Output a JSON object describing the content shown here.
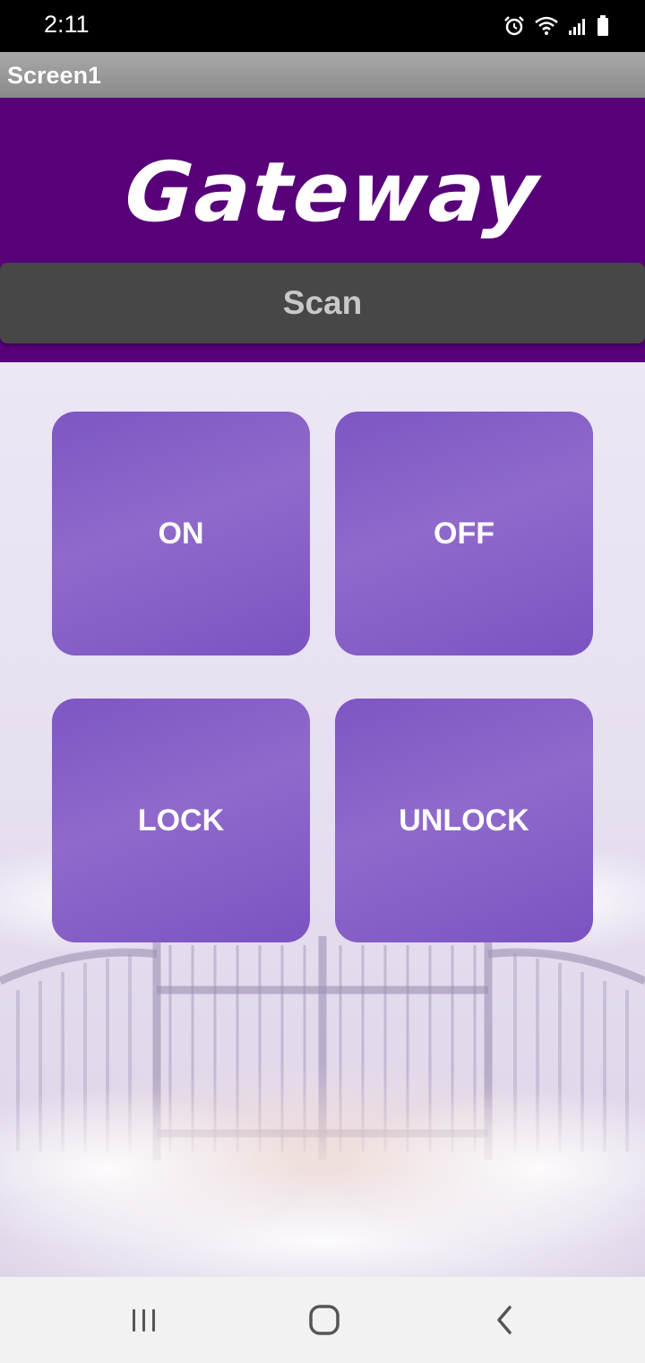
{
  "status_bar": {
    "time": "2:11",
    "icons": [
      "alarm-icon",
      "wifi-icon",
      "signal-icon",
      "battery-icon"
    ]
  },
  "title_bar": {
    "title": "Screen1"
  },
  "header": {
    "logo_text": "Gateway",
    "scan_label": "Scan",
    "background_color": "#570079"
  },
  "controls": {
    "on_label": "ON",
    "off_label": "OFF",
    "lock_label": "LOCK",
    "unlock_label": "UNLOCK",
    "button_color": "#7d56c3"
  },
  "nav_bar": {
    "icons": [
      "recents-icon",
      "home-icon",
      "back-icon"
    ]
  }
}
